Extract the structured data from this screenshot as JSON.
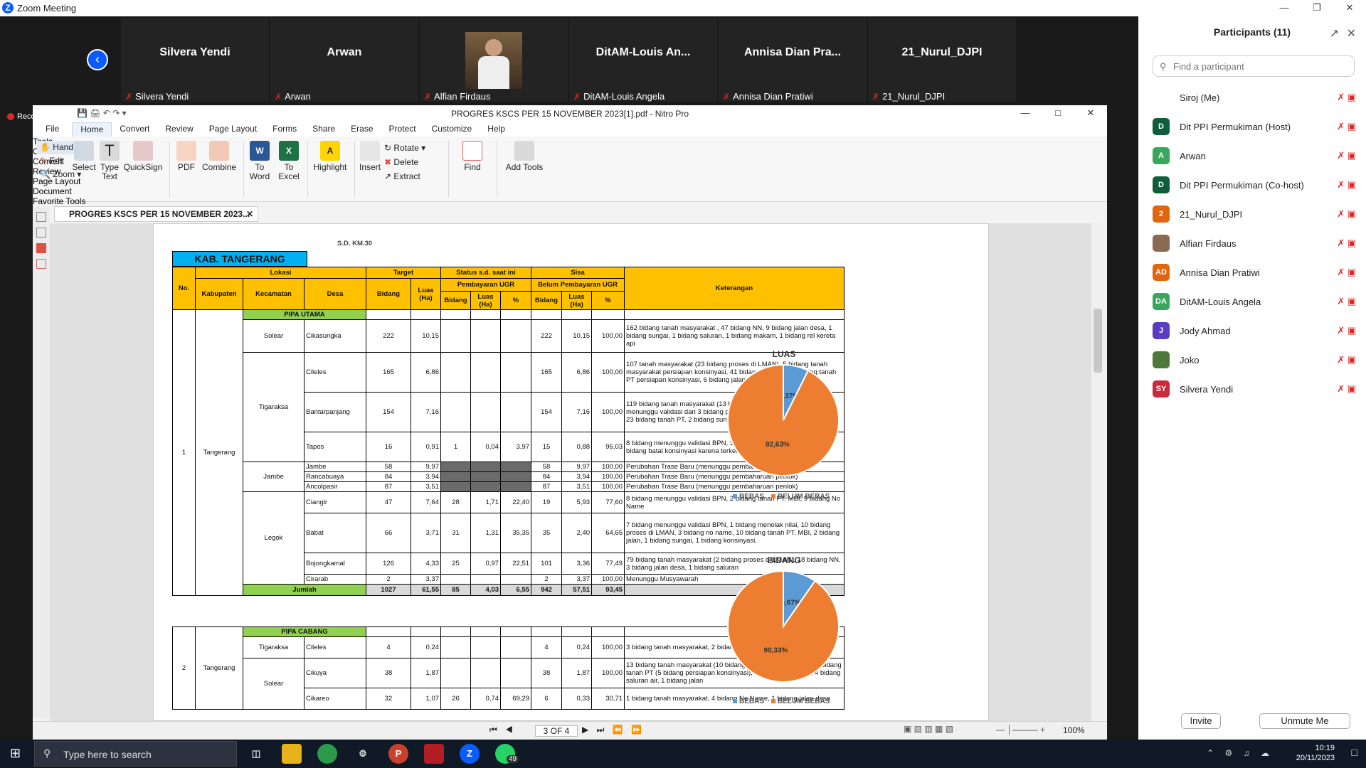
{
  "zoom": {
    "title": "Zoom Meeting",
    "recording": "Recording"
  },
  "tiles": [
    {
      "name": "Silvera Yendi",
      "label": "Silvera Yendi"
    },
    {
      "name": "Arwan",
      "label": "Arwan"
    },
    {
      "name": "",
      "label": "Alfian Firdaus"
    },
    {
      "name": "DitAM-Louis An...",
      "label": "DitAM-Louis Angela"
    },
    {
      "name": "Annisa Dian Pra...",
      "label": "Annisa Dian Pratiwi"
    },
    {
      "name": "21_Nurul_DJPI",
      "label": "21_Nurul_DJPI"
    }
  ],
  "nitro": {
    "title": "PROGRES KSCS PER 15 NOVEMBER 2023[1].pdf - Nitro Pro",
    "menu": [
      "File",
      "Home",
      "Convert",
      "Review",
      "Page Layout",
      "Forms",
      "Share",
      "Erase",
      "Protect",
      "Customize",
      "Help"
    ],
    "ribbon": {
      "hand": "Hand",
      "edit": "Edit",
      "zoom": "Zoom",
      "select": "Select",
      "type_text": "Type Text",
      "quicksign": "QuickSign",
      "tools_group": "Tools",
      "pdf": "PDF",
      "combine": "Combine",
      "create_group": "Create",
      "to_word": "To Word",
      "to_excel": "To Excel",
      "convert_group": "Convert",
      "highlight": "Highlight",
      "review_group": "Review",
      "insert": "Insert",
      "rotate": "Rotate",
      "delete": "Delete",
      "extract": "Extract",
      "page_layout_group": "Page Layout",
      "find": "Find",
      "document_group": "Document",
      "add_tools": "Add Tools",
      "favorite_group": "Favorite Tools"
    },
    "doc_tab": "PROGRES KSCS PER 15 NOVEMBER 2023...",
    "page_indicator": "3 OF 4",
    "zoom_level": "100%"
  },
  "pdf": {
    "top_cut": "S.D. KM.30",
    "region_title": "KAB. TANGERANG",
    "headers": {
      "no": "No.",
      "lokasi": "Lokasi",
      "kabupaten": "Kabupaten",
      "kecamatan": "Kecamatan",
      "desa": "Desa",
      "target": "Target",
      "bidang": "Bidang",
      "luas": "Luas (Ha)",
      "status": "Status s.d. saat ini",
      "pembayaran": "Pembayaran UGR",
      "pct": "%",
      "sisa": "Sisa",
      "belum": "Belum Pembayaran UGR",
      "keterangan": "Keterangan"
    },
    "utama_label": "PIPA UTAMA",
    "utama_no": "1",
    "utama_kab": "Tangerang",
    "rows": [
      {
        "kec": "Solear",
        "desa": "Cikasungka",
        "tb": "222",
        "tl": "10,15",
        "pb": "",
        "pl": "",
        "pp": "",
        "sb": "222",
        "sl": "10,15",
        "sp": "100,00",
        "ket": "162 bidang tanah masyarakat , 47 bidang NN, 9 bidang jalan desa, 1 bidang sungai, 1 bidang saluran, 1 bidang makam, 1 bidang rel kereta api"
      },
      {
        "kec": "",
        "desa": "Cileles",
        "tb": "165",
        "tl": "6,86",
        "pb": "",
        "pl": "",
        "pp": "",
        "sb": "165",
        "sl": "6,86",
        "sp": "100,00",
        "ket": "107 tanah masyarakat (23 bidang proses di LMAN), 5 bidang tanah masyarakat persiapan konsinyasi, 41 bidang no name, 3 bidang tanah PT persiapan konsinyasi, 6 bidang jalan desa, 1 bidang sungai"
      },
      {
        "kec": "Tigaraksa",
        "desa": "Bantarpanjang",
        "tb": "154",
        "tl": "7,16",
        "pb": "",
        "pl": "",
        "pp": "",
        "sb": "154",
        "sl": "7,16",
        "sp": "100,00",
        "ket": "119 bidang tanah masyarakat (13 bidang berkas lengkap di BPN menunggu validasi dan 3 bidang proses di LMAN), 6 bidang No Name, 23 bidang tanah PT, 2 bidang sungai, 4 bidang jalan desa."
      },
      {
        "kec": "",
        "desa": "Tapos",
        "tb": "16",
        "tl": "0,91",
        "pb": "1",
        "pl": "0,04",
        "pp": "3,97",
        "sb": "15",
        "sl": "0,88",
        "sp": "96,03",
        "ket": "8 bidang menunggu validasi BPN, 3 bidang persiapan konsinyasi, 4 bidang batal konsinyasi karena terkena perubahan trase baru"
      },
      {
        "kec": "",
        "desa": "Jambe",
        "tb": "58",
        "tl": "9,97",
        "pb": "",
        "pl": "",
        "pp": "",
        "sb": "58",
        "sl": "9,97",
        "sp": "100,00",
        "ket": "Perubahan Trase Baru (menunggu pembaharuan penlok)"
      },
      {
        "kec": "Jambe",
        "desa": "Rancabuaya",
        "tb": "84",
        "tl": "3,94",
        "pb": "",
        "pl": "",
        "pp": "",
        "sb": "84",
        "sl": "3,94",
        "sp": "100,00",
        "ket": "Perubahan Trase Baru (menunggu pembaharuan penlok)"
      },
      {
        "kec": "",
        "desa": "Ancolpasir",
        "tb": "87",
        "tl": "3,51",
        "pb": "",
        "pl": "",
        "pp": "",
        "sb": "87",
        "sl": "3,51",
        "sp": "100,00",
        "ket": "Perubahan Trase Baru (menunggu pembaharuan penlok)"
      },
      {
        "kec": "",
        "desa": "Ciangir",
        "tb": "47",
        "tl": "7,64",
        "pb": "28",
        "pl": "1,71",
        "pp": "22,40",
        "sb": "19",
        "sl": "5,93",
        "sp": "77,60",
        "ket": "8 bidang menunggu validasi BPN, 2 bidang tanah PT. MBI, 9 bidang No Name"
      },
      {
        "kec": "Legok",
        "desa": "Babat",
        "tb": "66",
        "tl": "3,71",
        "pb": "31",
        "pl": "1,31",
        "pp": "35,35",
        "sb": "35",
        "sl": "2,40",
        "sp": "64,65",
        "ket": "7 bidang menunggu validasi BPN, 1 bidang menolak nilai, 10 bidang proses di LMAN, 3 bidang no name, 10 bidang tanah PT. MBI, 2 bidang jalan, 1 bidang sungai, 1 bidang konsinyasi."
      },
      {
        "kec": "",
        "desa": "Bojongkamal",
        "tb": "126",
        "tl": "4,33",
        "pb": "25",
        "pl": "0,97",
        "pp": "22,51",
        "sb": "101",
        "sl": "3,36",
        "sp": "77,49",
        "ket": "79 bidang tanah masyarakat (2 bidang proses di LMAN), 18 bidang NN, 3 bidang jalan desa, 1 bidang saluran"
      },
      {
        "kec": "",
        "desa": "Cirarab",
        "tb": "2",
        "tl": "3,37",
        "pb": "",
        "pl": "",
        "pp": "",
        "sb": "2",
        "sl": "3,37",
        "sp": "100,00",
        "ket": "Menunggu Musyawarah"
      }
    ],
    "jumlah": {
      "label": "Jumlah",
      "tb": "1027",
      "tl": "61,55",
      "pb": "85",
      "pl": "4,03",
      "pp": "6,55",
      "sb": "942",
      "sl": "57,51",
      "sp": "93,45"
    },
    "cabang_label": "PIPA CABANG",
    "cabang_no": "2",
    "cabang_kab": "Tangerang",
    "cabang_rows": [
      {
        "kec": "Tigaraksa",
        "desa": "Cileles",
        "tb": "4",
        "tl": "0,24",
        "pb": "",
        "pl": "",
        "pp": "",
        "sb": "4",
        "sl": "0,24",
        "sp": "100,00",
        "ket": "3 bidang tanah masyarakat, 2 bidang NN, 1 bidang jalan desa"
      },
      {
        "kec": "",
        "desa": "Cikuya",
        "tb": "38",
        "tl": "1,87",
        "pb": "",
        "pl": "",
        "pp": "",
        "sb": "38",
        "sl": "1,87",
        "sp": "100,00",
        "ket": "13 bidang tanah masyarakat (10 bidang kekurangan C desa), 16 bidang tanah PT (5 bidang persiapan konsinyasi), 4 bidang No Name, 4 bidang saluran air, 1 bidang jalan"
      },
      {
        "kec": "Solear",
        "desa": "Cikareo",
        "tb": "32",
        "tl": "1,07",
        "pb": "26",
        "pl": "0,74",
        "pp": "69,29",
        "sb": "6",
        "sl": "0,33",
        "sp": "30,71",
        "ket": "1 bidang tanah masyarakat, 4 bidang No Name, 1 bidang jalan desa"
      }
    ]
  },
  "chart_data": [
    {
      "type": "pie",
      "title": "LUAS",
      "categories": [
        "BEBAS",
        "BELUM BEBAS"
      ],
      "values": [
        7.37,
        92.63
      ],
      "labels": [
        "7,37%",
        "92,63%"
      ],
      "colors": [
        "#5b9bd5",
        "#ed7d31"
      ],
      "legend": "bottom"
    },
    {
      "type": "pie",
      "title": "BIDANG",
      "categories": [
        "BEBAS",
        "BELUM BEBAS"
      ],
      "values": [
        9.67,
        90.33
      ],
      "labels": [
        "9,67%",
        "90,33%"
      ],
      "colors": [
        "#5b9bd5",
        "#ed7d31"
      ],
      "legend": "bottom"
    }
  ],
  "participants": {
    "title": "Participants (11)",
    "search_placeholder": "Find a participant",
    "list": [
      {
        "initials": "",
        "name": "Siroj (Me)",
        "color": "#ffffff"
      },
      {
        "initials": "D",
        "name": "Dit PPI Permukiman (Host)",
        "color": "#0e5e3b"
      },
      {
        "initials": "A",
        "name": "Arwan",
        "color": "#3aa55c"
      },
      {
        "initials": "D",
        "name": "Dit PPI Permukiman (Co-host)",
        "color": "#0e5e3b"
      },
      {
        "initials": "2",
        "name": "21_Nurul_DJPI",
        "color": "#e0650d"
      },
      {
        "initials": "",
        "name": "Alfian Firdaus",
        "color": "#8a6a55"
      },
      {
        "initials": "AD",
        "name": "Annisa Dian Pratiwi",
        "color": "#e0650d"
      },
      {
        "initials": "DA",
        "name": "DitAM-Louis Angela",
        "color": "#3aa55c"
      },
      {
        "initials": "J",
        "name": "Jody Ahmad",
        "color": "#5b3cc4"
      },
      {
        "initials": "",
        "name": "Joko",
        "color": "#4d7a3a"
      },
      {
        "initials": "SY",
        "name": "Silvera Yendi",
        "color": "#c92a3c"
      }
    ],
    "invite": "Invite",
    "unmute": "Unmute Me"
  },
  "taskbar": {
    "search": "Type here to search",
    "time": "10:19",
    "date": "20/11/2023",
    "badge": "49"
  }
}
